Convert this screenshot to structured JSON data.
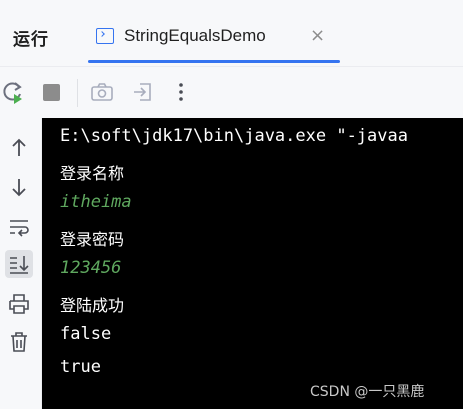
{
  "header": {
    "run_title": "运行",
    "tab": {
      "label": "StringEqualsDemo",
      "close": "×"
    }
  },
  "toolbar": {
    "icons": [
      "rerun-icon",
      "stop-icon",
      "screenshot-icon",
      "exit-icon",
      "more-icon"
    ]
  },
  "sidebar": {
    "icons": [
      "up-arrow-icon",
      "down-arrow-icon",
      "soft-wrap-icon",
      "scroll-to-end-icon",
      "print-icon",
      "trash-icon"
    ]
  },
  "console": {
    "lines": [
      {
        "text": "E:\\soft\\jdk17\\bin\\java.exe \"-javaa",
        "kind": "command"
      },
      {
        "text": "登录名称",
        "kind": "output"
      },
      {
        "text": "itheima",
        "kind": "input"
      },
      {
        "text": "登录密码",
        "kind": "output"
      },
      {
        "text": "123456",
        "kind": "input"
      },
      {
        "text": "登陆成功",
        "kind": "output"
      },
      {
        "text": "false",
        "kind": "output"
      },
      {
        "text": "true",
        "kind": "output"
      }
    ]
  },
  "watermark": "CSDN @一只黑鹿",
  "colors": {
    "accent": "#3574f0",
    "input_text": "#5fa85f",
    "console_bg": "#000000",
    "rerun_play": "#4caf50"
  }
}
